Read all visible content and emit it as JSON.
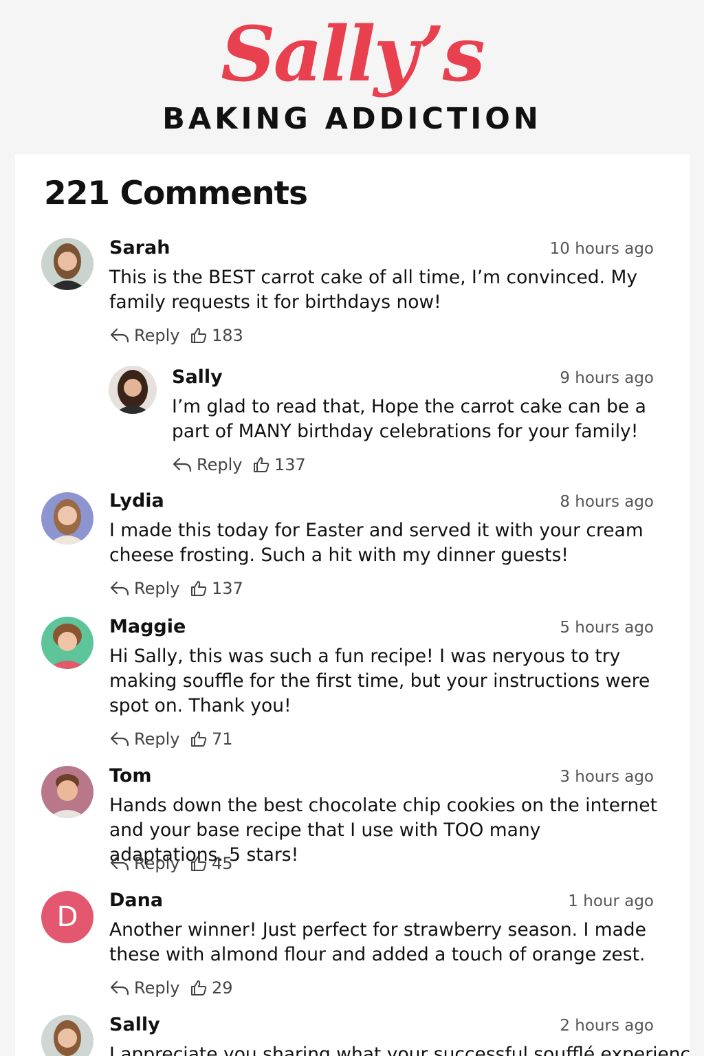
{
  "header": {
    "logo_script": "Sally’s",
    "logo_sub": "BAKING ADDICTION"
  },
  "comments_count": "221 Comments",
  "reply_label": "Reply",
  "comments": [
    {
      "name": "Sarah",
      "time": "10 hours ago",
      "text": "This is the BEST carrot cake of all time, I’m convinced. My family requests it for birthdays now!",
      "likes": "183"
    },
    {
      "name": "Sally",
      "time": "9 hours ago",
      "text": "I’m glad to read that, Hope the carrot cake can be a part of MANY birthday celebrations for your family!",
      "likes": "137"
    },
    {
      "name": "Lydia",
      "time": "8 hours ago",
      "text": "I made this today for Easter and served it with your cream cheese frosting. Such a hit with my dinner guests!",
      "likes": "137"
    },
    {
      "name": "Maggie",
      "time": "5 hours ago",
      "text": "Hi Sally, this was such a fun recipe! I was neryous to try making souffle for the first time, but your instructions were spot on. Thank you!",
      "likes": "71"
    },
    {
      "name": "Tom",
      "time": "3 hours ago",
      "text": "Hands down the best chocolate chip cookies on the internet and your base recipe that I use with TOO many adaptations. 5 stars!",
      "likes": "45"
    },
    {
      "name": "Dana",
      "avatar_letter": "D",
      "time": "1 hour ago",
      "text": "Another winner! Just perfect for strawberry season. I made these with almond flour and added a touch of orange zest.",
      "likes": "29"
    },
    {
      "name": "Sally",
      "time": "2 hours ago",
      "text": "I appreciate you sharing what your successful soufflé experience"
    }
  ],
  "colors": {
    "brand": "#e8404e",
    "dana_avatar": "#e4586f"
  }
}
